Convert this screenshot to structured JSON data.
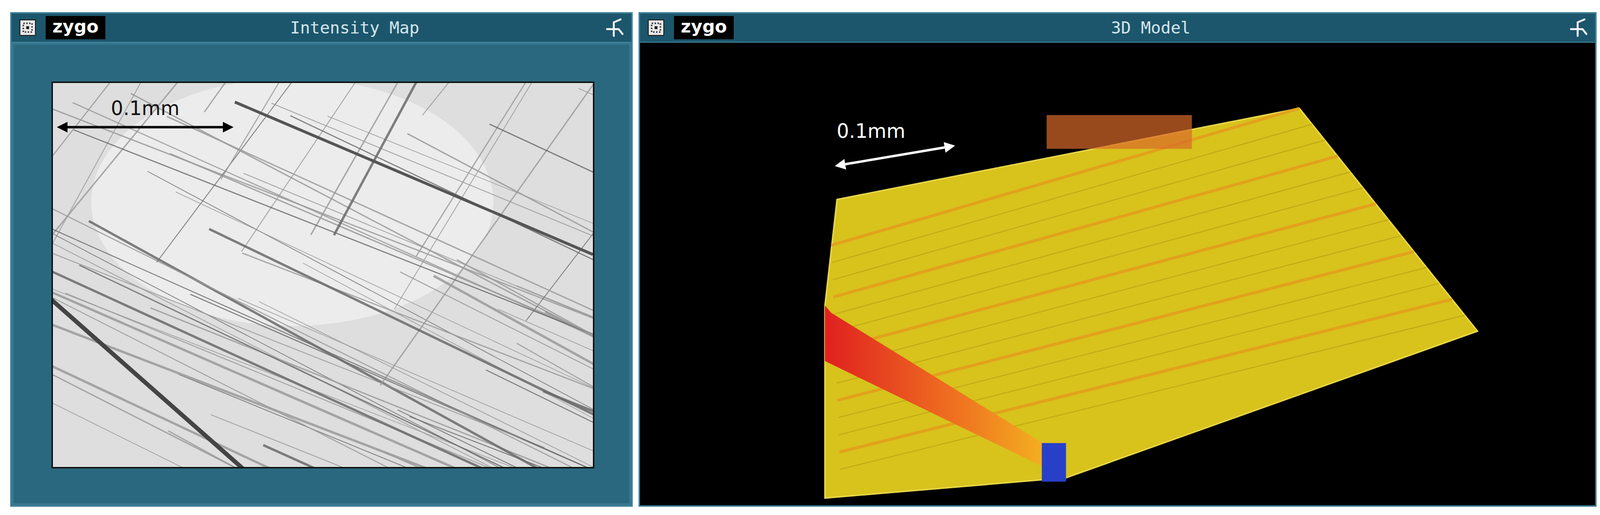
{
  "windows": [
    {
      "kind": "intensity",
      "logo": "zygo",
      "title": "Intensity Map",
      "scale_label": "0.1mm"
    },
    {
      "kind": "model",
      "logo": "zygo",
      "title": "3D Model",
      "scale_label": "0.1mm"
    }
  ]
}
